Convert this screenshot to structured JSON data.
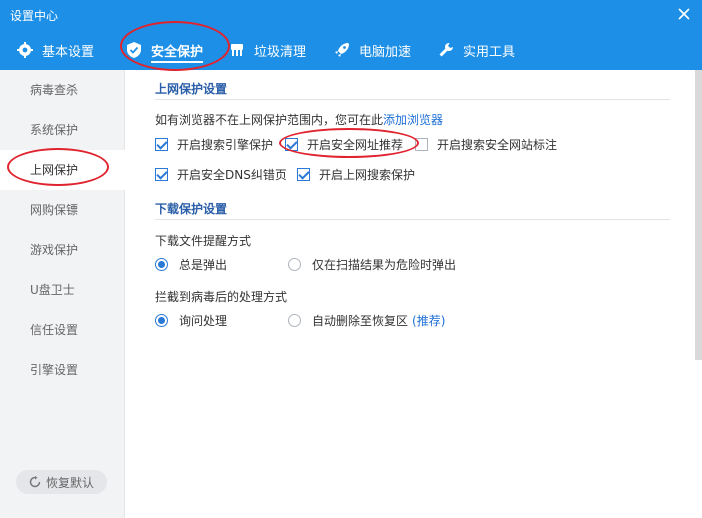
{
  "window": {
    "title": "设置中心"
  },
  "tabs": [
    {
      "label": "基本设置",
      "icon": "gear-icon"
    },
    {
      "label": "安全保护",
      "icon": "shield-check-icon"
    },
    {
      "label": "垃圾清理",
      "icon": "broom-icon"
    },
    {
      "label": "电脑加速",
      "icon": "rocket-icon"
    },
    {
      "label": "实用工具",
      "icon": "wrench-icon"
    }
  ],
  "active_tab": "安全保护",
  "sidebar": {
    "items": [
      "病毒查杀",
      "系统保护",
      "上网保护",
      "网购保镖",
      "游戏保护",
      "U盘卫士",
      "信任设置",
      "引擎设置"
    ],
    "active": "上网保护",
    "restore_label": "恢复默认"
  },
  "web_protection": {
    "title": "上网保护设置",
    "hint_text": "如有浏览器不在上网保护范围内，您可在此",
    "hint_link": "添加浏览器",
    "options": [
      {
        "label": "开启搜索引擎保护",
        "checked": true
      },
      {
        "label": "开启安全网址推荐",
        "checked": true
      },
      {
        "label": "开启搜索安全网站标注",
        "checked": false
      },
      {
        "label": "开启安全DNS纠错页",
        "checked": true
      },
      {
        "label": "开启上网搜索保护",
        "checked": true
      }
    ]
  },
  "download_protection": {
    "title": "下载保护设置",
    "reminder": {
      "label": "下载文件提醒方式",
      "options": [
        {
          "label": "总是弹出",
          "selected": true
        },
        {
          "label": "仅在扫描结果为危险时弹出",
          "selected": false
        }
      ]
    },
    "virus_action": {
      "label": "拦截到病毒后的处理方式",
      "options": [
        {
          "label": "询问处理",
          "selected": true
        },
        {
          "label": "自动删除至恢复区",
          "suffix": "(推荐)",
          "selected": false
        }
      ]
    }
  },
  "colors": {
    "header": "#1d8fe6",
    "accent": "#2b79d6",
    "annotation": "#e0242f"
  }
}
